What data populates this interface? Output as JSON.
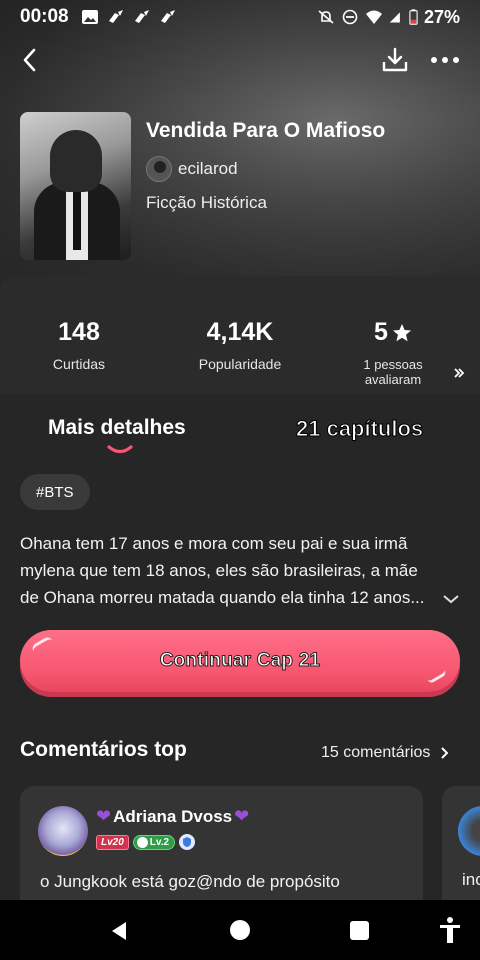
{
  "status_bar": {
    "time": "00:08",
    "battery": "27%",
    "icons": [
      "gallery-icon",
      "brush-icon",
      "brush-icon",
      "brush-icon",
      "mute-icon",
      "dnd-icon",
      "wifi-icon",
      "signal-icon",
      "battery-icon"
    ]
  },
  "top_bar": {
    "back_icon": "chevron-left-icon",
    "download_icon": "download-icon",
    "more_icon": "more-dots-icon"
  },
  "story": {
    "title": "Vendida Para O Mafioso",
    "author": "ecilarod",
    "genre": "Ficção Histórica"
  },
  "stats": {
    "likes_value": "148",
    "likes_label": "Curtidas",
    "popularity_value": "4,14K",
    "popularity_label": "Popularidade",
    "rating_value": "5",
    "rating_label_1": "1 pessoas",
    "rating_label_2": "avaliaram"
  },
  "tabs": {
    "details": "Mais detalhes",
    "chapters": "21 capítulos"
  },
  "tag": "#BTS",
  "synopsis": "Ohana tem 17 anos e mora com seu pai e sua irmã mylena que tem 18 anos, eles são brasileiras, a mãe de Ohana morreu matada quando ela tinha 12 anos...",
  "continue_button": "Continuar Cap 21",
  "comments": {
    "heading": "Comentários top",
    "count": "15 comentários",
    "items": [
      {
        "user": "Adriana Dvoss",
        "badge_level": "Lv20",
        "badge_rank": "Lv.2",
        "text": "o Jungkook está goz@ndo de propósito"
      },
      {
        "text": "inc"
      }
    ]
  },
  "colors": {
    "accent": "#f7566f",
    "background": "#262626",
    "card": "#343434"
  }
}
